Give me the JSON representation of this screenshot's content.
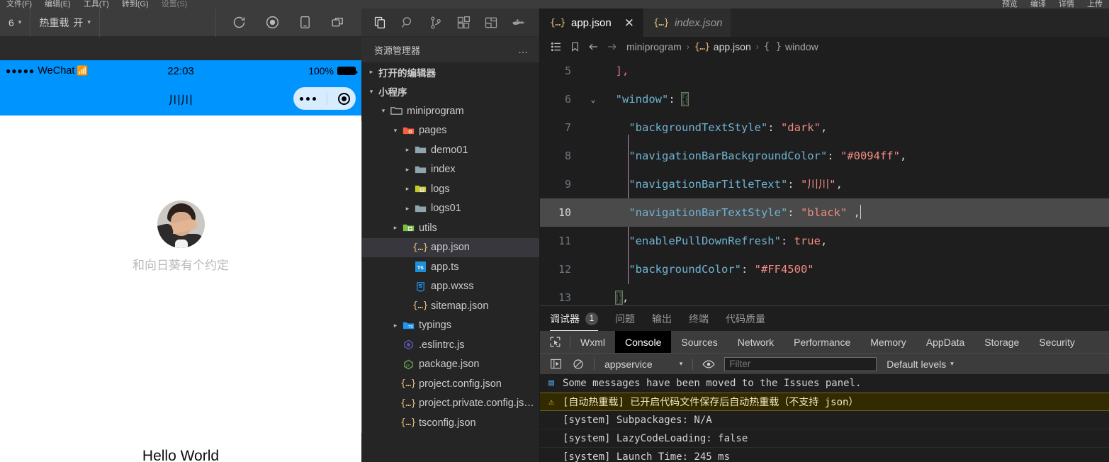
{
  "menubar": {
    "items": [
      "文件(F)",
      "编辑(E)",
      "工具(T)",
      "转到(G)",
      "设置(S)"
    ],
    "right_items": [
      "预览",
      "编译",
      "详情",
      "上传"
    ]
  },
  "simulator": {
    "toolbar": {
      "device": "6",
      "hotreload_label": "热重载",
      "hotreload_value": "开",
      "icons": [
        "refresh-icon",
        "record-icon",
        "phone-icon",
        "windows-icon"
      ]
    },
    "statusbar": {
      "carrier": "WeChat",
      "dots": "●●●●●",
      "time": "22:03",
      "battery": "100%"
    },
    "navbar": {
      "title": "川川",
      "capsule_more": "more-icon",
      "capsule_target": "target-icon"
    },
    "page": {
      "avatar_alt": "user-avatar",
      "caption": "和向日葵有个约定",
      "hello": "Hello World"
    }
  },
  "activitybar": {
    "icons": [
      {
        "name": "explorer-icon",
        "active": true
      },
      {
        "name": "search-icon",
        "active": false
      },
      {
        "name": "source-control-icon",
        "active": false
      },
      {
        "name": "extensions-icon",
        "active": false
      },
      {
        "name": "layout-icon",
        "active": false
      },
      {
        "name": "docker-icon",
        "active": false
      }
    ]
  },
  "explorer": {
    "title": "资源管理器",
    "more": "…",
    "tree": [
      {
        "label": "打开的编辑器",
        "depth": 0,
        "twisty": "▸",
        "icon": "",
        "section": true
      },
      {
        "label": "小程序",
        "depth": 0,
        "twisty": "▾",
        "icon": "",
        "section": true
      },
      {
        "label": "miniprogram",
        "depth": 1,
        "twisty": "▾",
        "icon": "folder-open-icon"
      },
      {
        "label": "pages",
        "depth": 2,
        "twisty": "▾",
        "icon": "folder-pages-icon"
      },
      {
        "label": "demo01",
        "depth": 3,
        "twisty": "▸",
        "icon": "folder-icon"
      },
      {
        "label": "index",
        "depth": 3,
        "twisty": "▸",
        "icon": "folder-icon"
      },
      {
        "label": "logs",
        "depth": 3,
        "twisty": "▸",
        "icon": "folder-logs-icon"
      },
      {
        "label": "logs01",
        "depth": 3,
        "twisty": "▸",
        "icon": "folder-icon"
      },
      {
        "label": "utils",
        "depth": 2,
        "twisty": "▸",
        "icon": "folder-utils-icon"
      },
      {
        "label": "app.json",
        "depth": 3,
        "twisty": "",
        "icon": "json-icon",
        "selected": true
      },
      {
        "label": "app.ts",
        "depth": 3,
        "twisty": "",
        "icon": "ts-icon"
      },
      {
        "label": "app.wxss",
        "depth": 3,
        "twisty": "",
        "icon": "css-icon"
      },
      {
        "label": "sitemap.json",
        "depth": 3,
        "twisty": "",
        "icon": "json-icon"
      },
      {
        "label": "typings",
        "depth": 2,
        "twisty": "▸",
        "icon": "folder-ts-icon"
      },
      {
        "label": ".eslintrc.js",
        "depth": 2,
        "twisty": "",
        "icon": "eslint-icon"
      },
      {
        "label": "package.json",
        "depth": 2,
        "twisty": "",
        "icon": "npm-icon"
      },
      {
        "label": "project.config.json",
        "depth": 2,
        "twisty": "",
        "icon": "json-icon"
      },
      {
        "label": "project.private.config.js…",
        "depth": 2,
        "twisty": "",
        "icon": "json-icon"
      },
      {
        "label": "tsconfig.json",
        "depth": 2,
        "twisty": "",
        "icon": "json-icon"
      }
    ]
  },
  "editor": {
    "tabs": [
      {
        "label": "app.json",
        "icon": "json-icon",
        "active": true,
        "closable": true,
        "preview": false
      },
      {
        "label": "index.json",
        "icon": "json-icon",
        "active": false,
        "closable": false,
        "preview": true
      }
    ],
    "close_glyph": "✕",
    "breadcrumb_icons": [
      "outline-icon",
      "bookmark-icon",
      "back-arrow-icon",
      "forward-arrow-icon"
    ],
    "breadcrumbs": [
      {
        "label": "miniprogram",
        "icon": ""
      },
      {
        "label": "app.json",
        "icon": "json-icon"
      },
      {
        "label": "window",
        "icon": "braces-icon"
      }
    ],
    "breadcrumb_sep": "›",
    "lines": [
      {
        "no": "5",
        "fold": "",
        "current": false,
        "tokens": [
          {
            "t": "  ",
            "c": "p"
          },
          {
            "t": "],",
            "c": "br"
          }
        ]
      },
      {
        "no": "6",
        "fold": "⌄",
        "current": false,
        "tokens": [
          {
            "t": "  ",
            "c": "p"
          },
          {
            "t": "\"window\"",
            "c": "k"
          },
          {
            "t": ": ",
            "c": "p"
          },
          {
            "t": "{",
            "c": "brmatch"
          }
        ]
      },
      {
        "no": "7",
        "fold": "",
        "current": false,
        "tokens": [
          {
            "t": "    ",
            "c": "p"
          },
          {
            "t": "\"backgroundTextStyle\"",
            "c": "k"
          },
          {
            "t": ": ",
            "c": "p"
          },
          {
            "t": "\"dark\"",
            "c": "s"
          },
          {
            "t": ",",
            "c": "p"
          }
        ]
      },
      {
        "no": "8",
        "fold": "",
        "current": false,
        "tokens": [
          {
            "t": "    ",
            "c": "p"
          },
          {
            "t": "\"navigationBarBackgroundColor\"",
            "c": "k"
          },
          {
            "t": ": ",
            "c": "p"
          },
          {
            "t": "\"#0094ff\"",
            "c": "s"
          },
          {
            "t": ",",
            "c": "p"
          }
        ]
      },
      {
        "no": "9",
        "fold": "",
        "current": false,
        "tokens": [
          {
            "t": "    ",
            "c": "p"
          },
          {
            "t": "\"navigationBarTitleText\"",
            "c": "k"
          },
          {
            "t": ": ",
            "c": "p"
          },
          {
            "t": "\"川川\"",
            "c": "s"
          },
          {
            "t": ",",
            "c": "p"
          }
        ]
      },
      {
        "no": "10",
        "fold": "",
        "current": true,
        "tokens": [
          {
            "t": "    ",
            "c": "p"
          },
          {
            "t": "\"navigationBarTextStyle\"",
            "c": "k"
          },
          {
            "t": ": ",
            "c": "p"
          },
          {
            "t": "\"black\"",
            "c": "s"
          },
          {
            "t": " ,",
            "c": "p"
          }
        ]
      },
      {
        "no": "11",
        "fold": "",
        "current": false,
        "tokens": [
          {
            "t": "    ",
            "c": "p"
          },
          {
            "t": "\"enablePullDownRefresh\"",
            "c": "k"
          },
          {
            "t": ": ",
            "c": "p"
          },
          {
            "t": "true",
            "c": "bool"
          },
          {
            "t": ",",
            "c": "p"
          }
        ]
      },
      {
        "no": "12",
        "fold": "",
        "current": false,
        "tokens": [
          {
            "t": "    ",
            "c": "p"
          },
          {
            "t": "\"backgroundColor\"",
            "c": "k"
          },
          {
            "t": ": ",
            "c": "p"
          },
          {
            "t": "\"#FF4500\"",
            "c": "s"
          }
        ]
      },
      {
        "no": "13",
        "fold": "",
        "current": false,
        "tokens": [
          {
            "t": "  ",
            "c": "p"
          },
          {
            "t": "}",
            "c": "brmatch"
          },
          {
            "t": ",",
            "c": "p"
          }
        ]
      }
    ]
  },
  "panel": {
    "tabs": [
      {
        "label": "调试器",
        "badge": "1",
        "active": true
      },
      {
        "label": "问题",
        "badge": "",
        "active": false
      },
      {
        "label": "输出",
        "badge": "",
        "active": false
      },
      {
        "label": "终端",
        "badge": "",
        "active": false
      },
      {
        "label": "代码质量",
        "badge": "",
        "active": false
      }
    ],
    "devtools_tabs": [
      {
        "label": "Wxml",
        "active": false
      },
      {
        "label": "Console",
        "active": true
      },
      {
        "label": "Sources",
        "active": false
      },
      {
        "label": "Network",
        "active": false
      },
      {
        "label": "Performance",
        "active": false
      },
      {
        "label": "Memory",
        "active": false
      },
      {
        "label": "AppData",
        "active": false
      },
      {
        "label": "Storage",
        "active": false
      },
      {
        "label": "Security",
        "active": false
      }
    ],
    "console_bar": {
      "sidebar_icon": "console-sidebar-icon",
      "clear_icon": "clear-console-icon",
      "context": "appservice",
      "eye_icon": "live-expression-icon",
      "filter_placeholder": "Filter",
      "filter_value": "",
      "levels": "Default levels"
    },
    "logs": [
      {
        "glyph": "▤",
        "kind": "info",
        "text": "Some messages have been moved to the Issues panel."
      },
      {
        "glyph": "⚠",
        "kind": "warn",
        "text": "[自动热重载] 已开启代码文件保存后自动热重载（不支持 json）"
      },
      {
        "glyph": "",
        "kind": "plain",
        "text": "[system] Subpackages: N/A"
      },
      {
        "glyph": "",
        "kind": "plain",
        "text": "[system] LazyCodeLoading: false"
      },
      {
        "glyph": "",
        "kind": "plain",
        "text": "[system] Launch Time: 245 ms"
      }
    ]
  },
  "colors": {
    "nav_blue": "#0094ff",
    "accent_orange": "#FF4500",
    "editor_bg": "#1e1e1e",
    "sidebar_bg": "#252526"
  }
}
